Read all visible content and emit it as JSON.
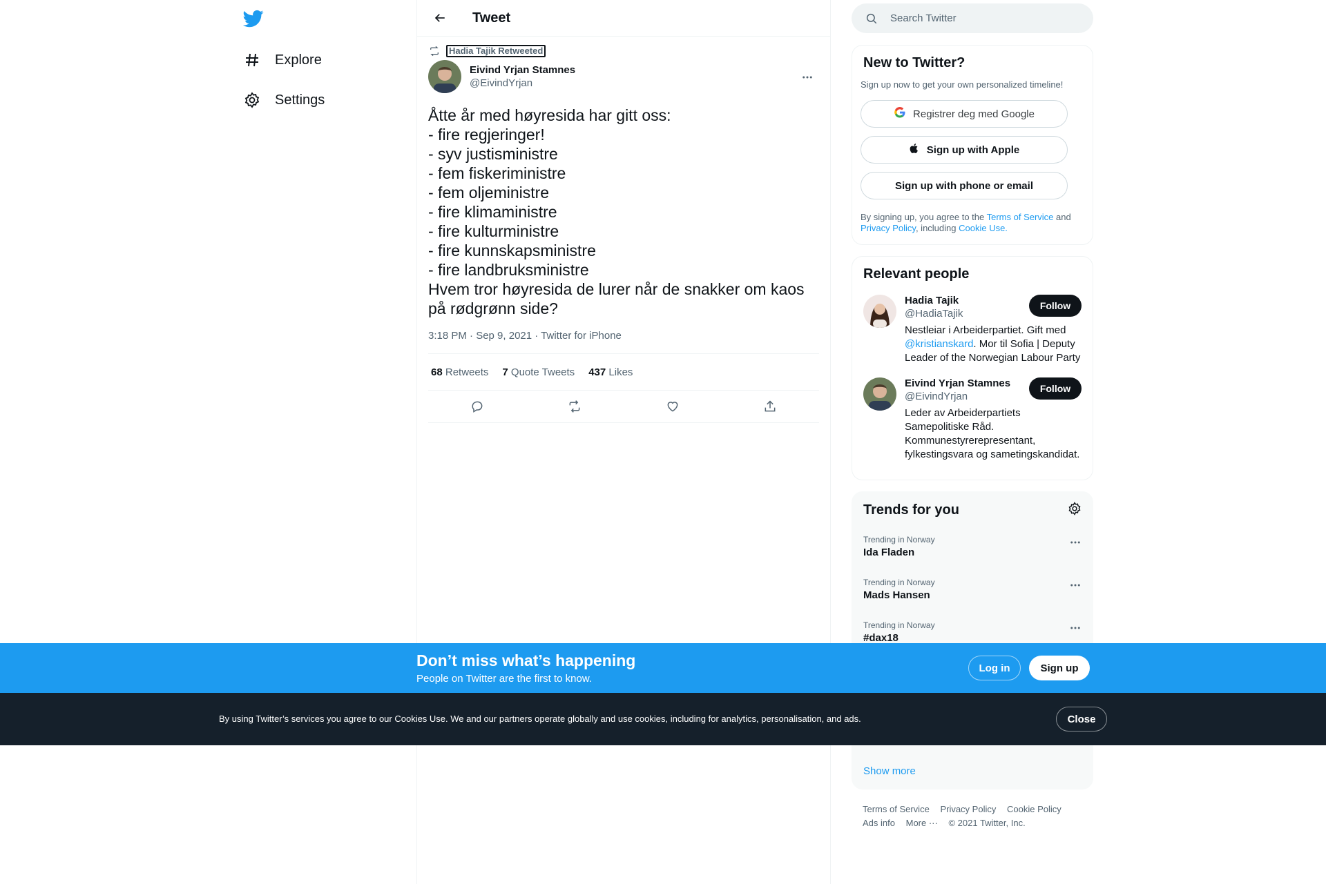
{
  "nav": {
    "items": [
      {
        "label": "Explore",
        "icon": "hashtag-icon"
      },
      {
        "label": "Settings",
        "icon": "gear-icon"
      }
    ]
  },
  "header": {
    "title": "Tweet"
  },
  "tweet": {
    "retweeted_by": "Hadia Tajik Retweeted",
    "author_name": "Eivind Yrjan Stamnes",
    "author_handle": "@EivindYrjan",
    "text": "Åtte år med høyresida har gitt oss:\n- fire regjeringer!\n- syv justisministre\n- fem fiskeriministre\n- fem oljeministre\n- fire klimaministre\n- fire kulturministre\n- fire kunnskapsministre\n- fire landbruksministre\nHvem tror høyresida de lurer når de snakker om kaos på rødgrønn side?",
    "timestamp": "3:18 PM · Sep 9, 2021 · Twitter for iPhone",
    "stats": {
      "retweets_count": "68",
      "retweets_label": "Retweets",
      "quotes_count": "7",
      "quotes_label": "Quote Tweets",
      "likes_count": "437",
      "likes_label": "Likes"
    }
  },
  "search": {
    "placeholder": "Search Twitter"
  },
  "new_to_twitter": {
    "title": "New to Twitter?",
    "subtitle": "Sign up now to get your own personalized timeline!",
    "google_label": "Registrer deg med Google",
    "apple_label": "Sign up with Apple",
    "phone_label": "Sign up with phone or email",
    "legal_prefix": "By signing up, you agree to the ",
    "terms": "Terms of Service",
    "and": " and ",
    "privacy": "Privacy Policy",
    "including": ", including ",
    "cookie": "Cookie Use."
  },
  "relevant_people": {
    "title": "Relevant people",
    "follow_label": "Follow",
    "people": [
      {
        "name": "Hadia Tajik",
        "handle": "@HadiaTajik",
        "bio_prefix": "Nestleiar i Arbeiderpartiet. Gift med ",
        "bio_mention": "@kristianskard",
        "bio_suffix": ". Mor til Sofia | Deputy Leader of the Norwegian Labour Party"
      },
      {
        "name": "Eivind Yrjan Stamnes",
        "handle": "@EivindYrjan",
        "bio": "Leder av Arbeiderpartiets Samepolitiske Råd. Kommunestyrerepresentant, fylkestingsvara og sametingskandidat."
      }
    ]
  },
  "trends": {
    "title": "Trends for you",
    "items": [
      {
        "context": "Trending in Norway",
        "name": "Ida Fladen"
      },
      {
        "context": "Trending in Norway",
        "name": "Mads Hansen"
      },
      {
        "context": "Trending in Norway",
        "name": "#dax18"
      }
    ],
    "show_more": "Show more"
  },
  "footer": {
    "links": [
      "Terms of Service",
      "Privacy Policy",
      "Cookie Policy",
      "Ads info",
      "More ···",
      "© 2021 Twitter, Inc."
    ]
  },
  "signup_banner": {
    "heading": "Don’t miss what’s happening",
    "sub": "People on Twitter are the first to know.",
    "login": "Log in",
    "signup": "Sign up"
  },
  "cookie_banner": {
    "text": "By using Twitter’s services you agree to our Cookies Use. We and our partners operate globally and use cookies, including for analytics, personalisation, and ads.",
    "close": "Close"
  },
  "colors": {
    "accent": "#1d9bf0",
    "text": "#0f1419",
    "muted": "#536471",
    "cookie_bg": "#15202b"
  }
}
